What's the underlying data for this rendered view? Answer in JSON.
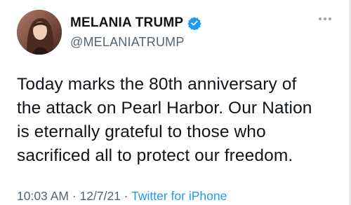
{
  "author": {
    "display_name": "MELANIA TRUMP",
    "handle": "@MELANIATRUMP",
    "verified_icon": "verified-badge-icon",
    "verified_color": "#1d9bf0"
  },
  "tweet": {
    "lines": [
      "Today marks the 80th anniversary of",
      "the attack on Pearl Harbor. Our Nation",
      "is eternally grateful to those who",
      "sacrificed all to protect our freedom."
    ]
  },
  "meta": {
    "time": "10:03 AM",
    "separator1": " · ",
    "date": "12/7/21",
    "separator2": " · ",
    "source": "Twitter for iPhone"
  },
  "colors": {
    "text": "#0f1419",
    "secondary": "#536471",
    "link": "#1d9bf0"
  },
  "icons": {
    "more": "more-options-icon",
    "avatar": "profile-avatar"
  }
}
